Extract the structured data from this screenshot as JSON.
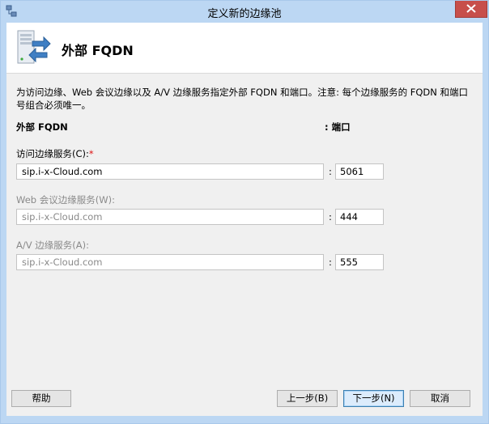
{
  "window": {
    "title": "定义新的边缘池",
    "icon": "app-icon",
    "close_icon": "close-icon"
  },
  "header": {
    "title": "外部 FQDN",
    "icon": "server-arrows-icon"
  },
  "description": "为访问边缘、Web 会议边缘以及 A/V 边缘服务指定外部 FQDN 和端口。注意: 每个边缘服务的 FQDN 和端口号组合必须唯一。",
  "columns": {
    "fqdn": "外部 FQDN",
    "port": ": 端口"
  },
  "fields": [
    {
      "label": "访问边缘服务(C):",
      "required_mark": "*",
      "value": "sip.i-x-Cloud.com",
      "colon": ":",
      "port": "5061",
      "enabled": true
    },
    {
      "label": "Web 会议边缘服务(W):",
      "required_mark": "",
      "value": "sip.i-x-Cloud.com",
      "colon": ":",
      "port": "444",
      "enabled": false
    },
    {
      "label": "A/V 边缘服务(A):",
      "required_mark": "",
      "value": "sip.i-x-Cloud.com",
      "colon": ":",
      "port": "555",
      "enabled": false
    }
  ],
  "buttons": {
    "help": "帮助",
    "back": "上一步(B)",
    "next": "下一步(N)",
    "cancel": "取消"
  },
  "colors": {
    "titlebar": "#bcd7f3",
    "close": "#c74f4a",
    "required": "#dd1111"
  }
}
